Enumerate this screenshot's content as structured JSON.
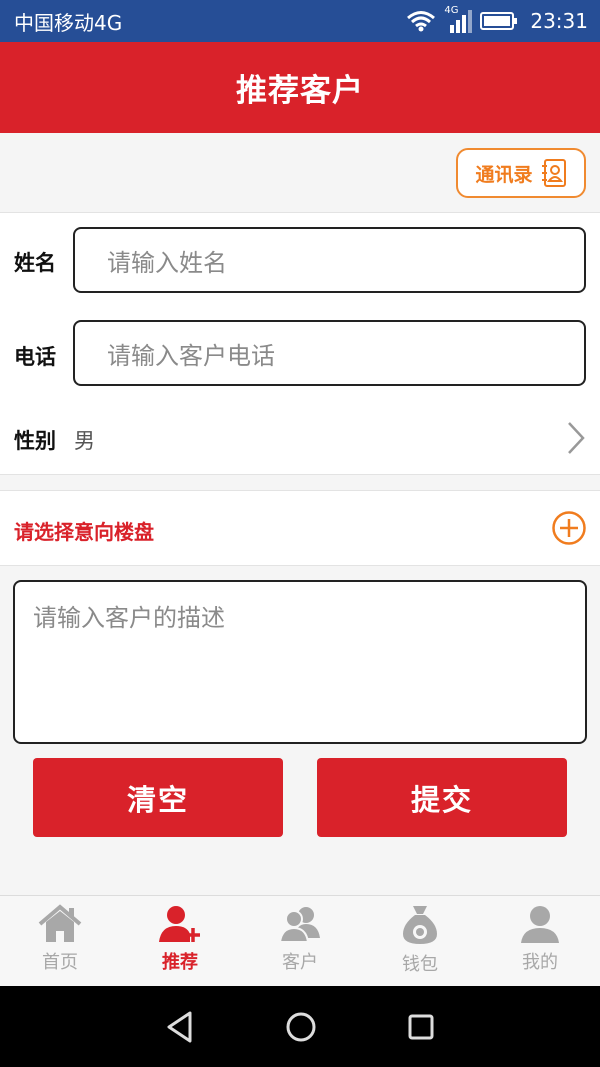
{
  "status_bar": {
    "carrier": "中国移动4G",
    "network_badge": "4G",
    "time": "23:31"
  },
  "app_bar": {
    "title": "推荐客户"
  },
  "contacts_button": {
    "label": "通讯录",
    "icon": "contact-book-icon"
  },
  "form": {
    "name": {
      "label": "姓名",
      "placeholder": "请输入姓名"
    },
    "phone": {
      "label": "电话",
      "placeholder": "请输入客户电话"
    },
    "gender": {
      "label": "性别",
      "value": "男"
    },
    "property": {
      "label": "请选择意向楼盘"
    },
    "description": {
      "placeholder": "请输入客户的描述"
    }
  },
  "actions": {
    "clear_label": "清空",
    "submit_label": "提交"
  },
  "tabs": [
    {
      "label": "首页",
      "icon": "home-icon",
      "active": false
    },
    {
      "label": "推荐",
      "icon": "add-user-icon",
      "active": true
    },
    {
      "label": "客户",
      "icon": "customers-icon",
      "active": false
    },
    {
      "label": "钱包",
      "icon": "money-bag-icon",
      "active": false
    },
    {
      "label": "我的",
      "icon": "profile-icon",
      "active": false
    }
  ],
  "colors": {
    "primary": "#d9222a",
    "accent": "#f07c1e",
    "status_bar": "#264e96"
  }
}
